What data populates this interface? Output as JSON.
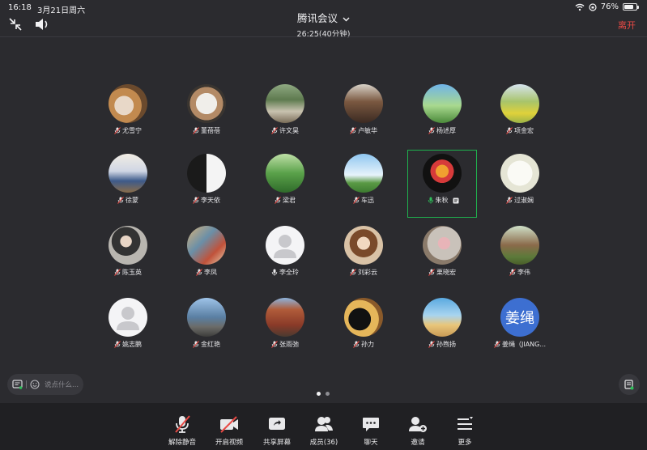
{
  "status": {
    "time": "16:18",
    "date": "3月21日周六",
    "battery": "76%",
    "battery_level": 0.76
  },
  "header": {
    "title": "腾讯会议",
    "duration": "26:25(40分钟)",
    "leave_label": "离开"
  },
  "participants": [
    {
      "name": "尤雪宁",
      "mic": "muted"
    },
    {
      "name": "董蓓蓓",
      "mic": "muted"
    },
    {
      "name": "许文昊",
      "mic": "muted"
    },
    {
      "name": "卢敏华",
      "mic": "muted"
    },
    {
      "name": "杨述厚",
      "mic": "muted"
    },
    {
      "name": "项金宏",
      "mic": "muted"
    },
    {
      "name": "徐蒙",
      "mic": "muted"
    },
    {
      "name": "李天依",
      "mic": "muted"
    },
    {
      "name": "梁君",
      "mic": "muted"
    },
    {
      "name": "车迅",
      "mic": "muted"
    },
    {
      "name": "朱秋",
      "mic": "speaking"
    },
    {
      "name": "过淑娴",
      "mic": "muted"
    },
    {
      "name": "陈玉英",
      "mic": "muted"
    },
    {
      "name": "李凤",
      "mic": "muted"
    },
    {
      "name": "李全玲",
      "mic": "on"
    },
    {
      "name": "刘彩云",
      "mic": "muted"
    },
    {
      "name": "栗晓宏",
      "mic": "muted"
    },
    {
      "name": "李伟",
      "mic": "muted"
    },
    {
      "name": "姚志鹏",
      "mic": "muted"
    },
    {
      "name": "金红艳",
      "mic": "muted"
    },
    {
      "name": "张雨弛",
      "mic": "muted"
    },
    {
      "name": "孙力",
      "mic": "muted"
    },
    {
      "name": "孙煦扬",
      "mic": "muted"
    },
    {
      "name": "姜绳（JIANG...",
      "mic": "muted",
      "avatar_text": "姜绳"
    }
  ],
  "chat": {
    "placeholder": "说点什么..."
  },
  "toolbar": {
    "unmute": "解除静音",
    "video": "开启视频",
    "share": "共享屏幕",
    "members": "成员(36)",
    "chat": "聊天",
    "invite": "邀请",
    "more": "更多"
  },
  "colors": {
    "background": "#2b2b2f",
    "toolbar": "#202023",
    "leave": "#e84a45",
    "active_border": "#1fb24e",
    "muted_red": "#e84a45",
    "mic_green": "#2fbf5a"
  }
}
